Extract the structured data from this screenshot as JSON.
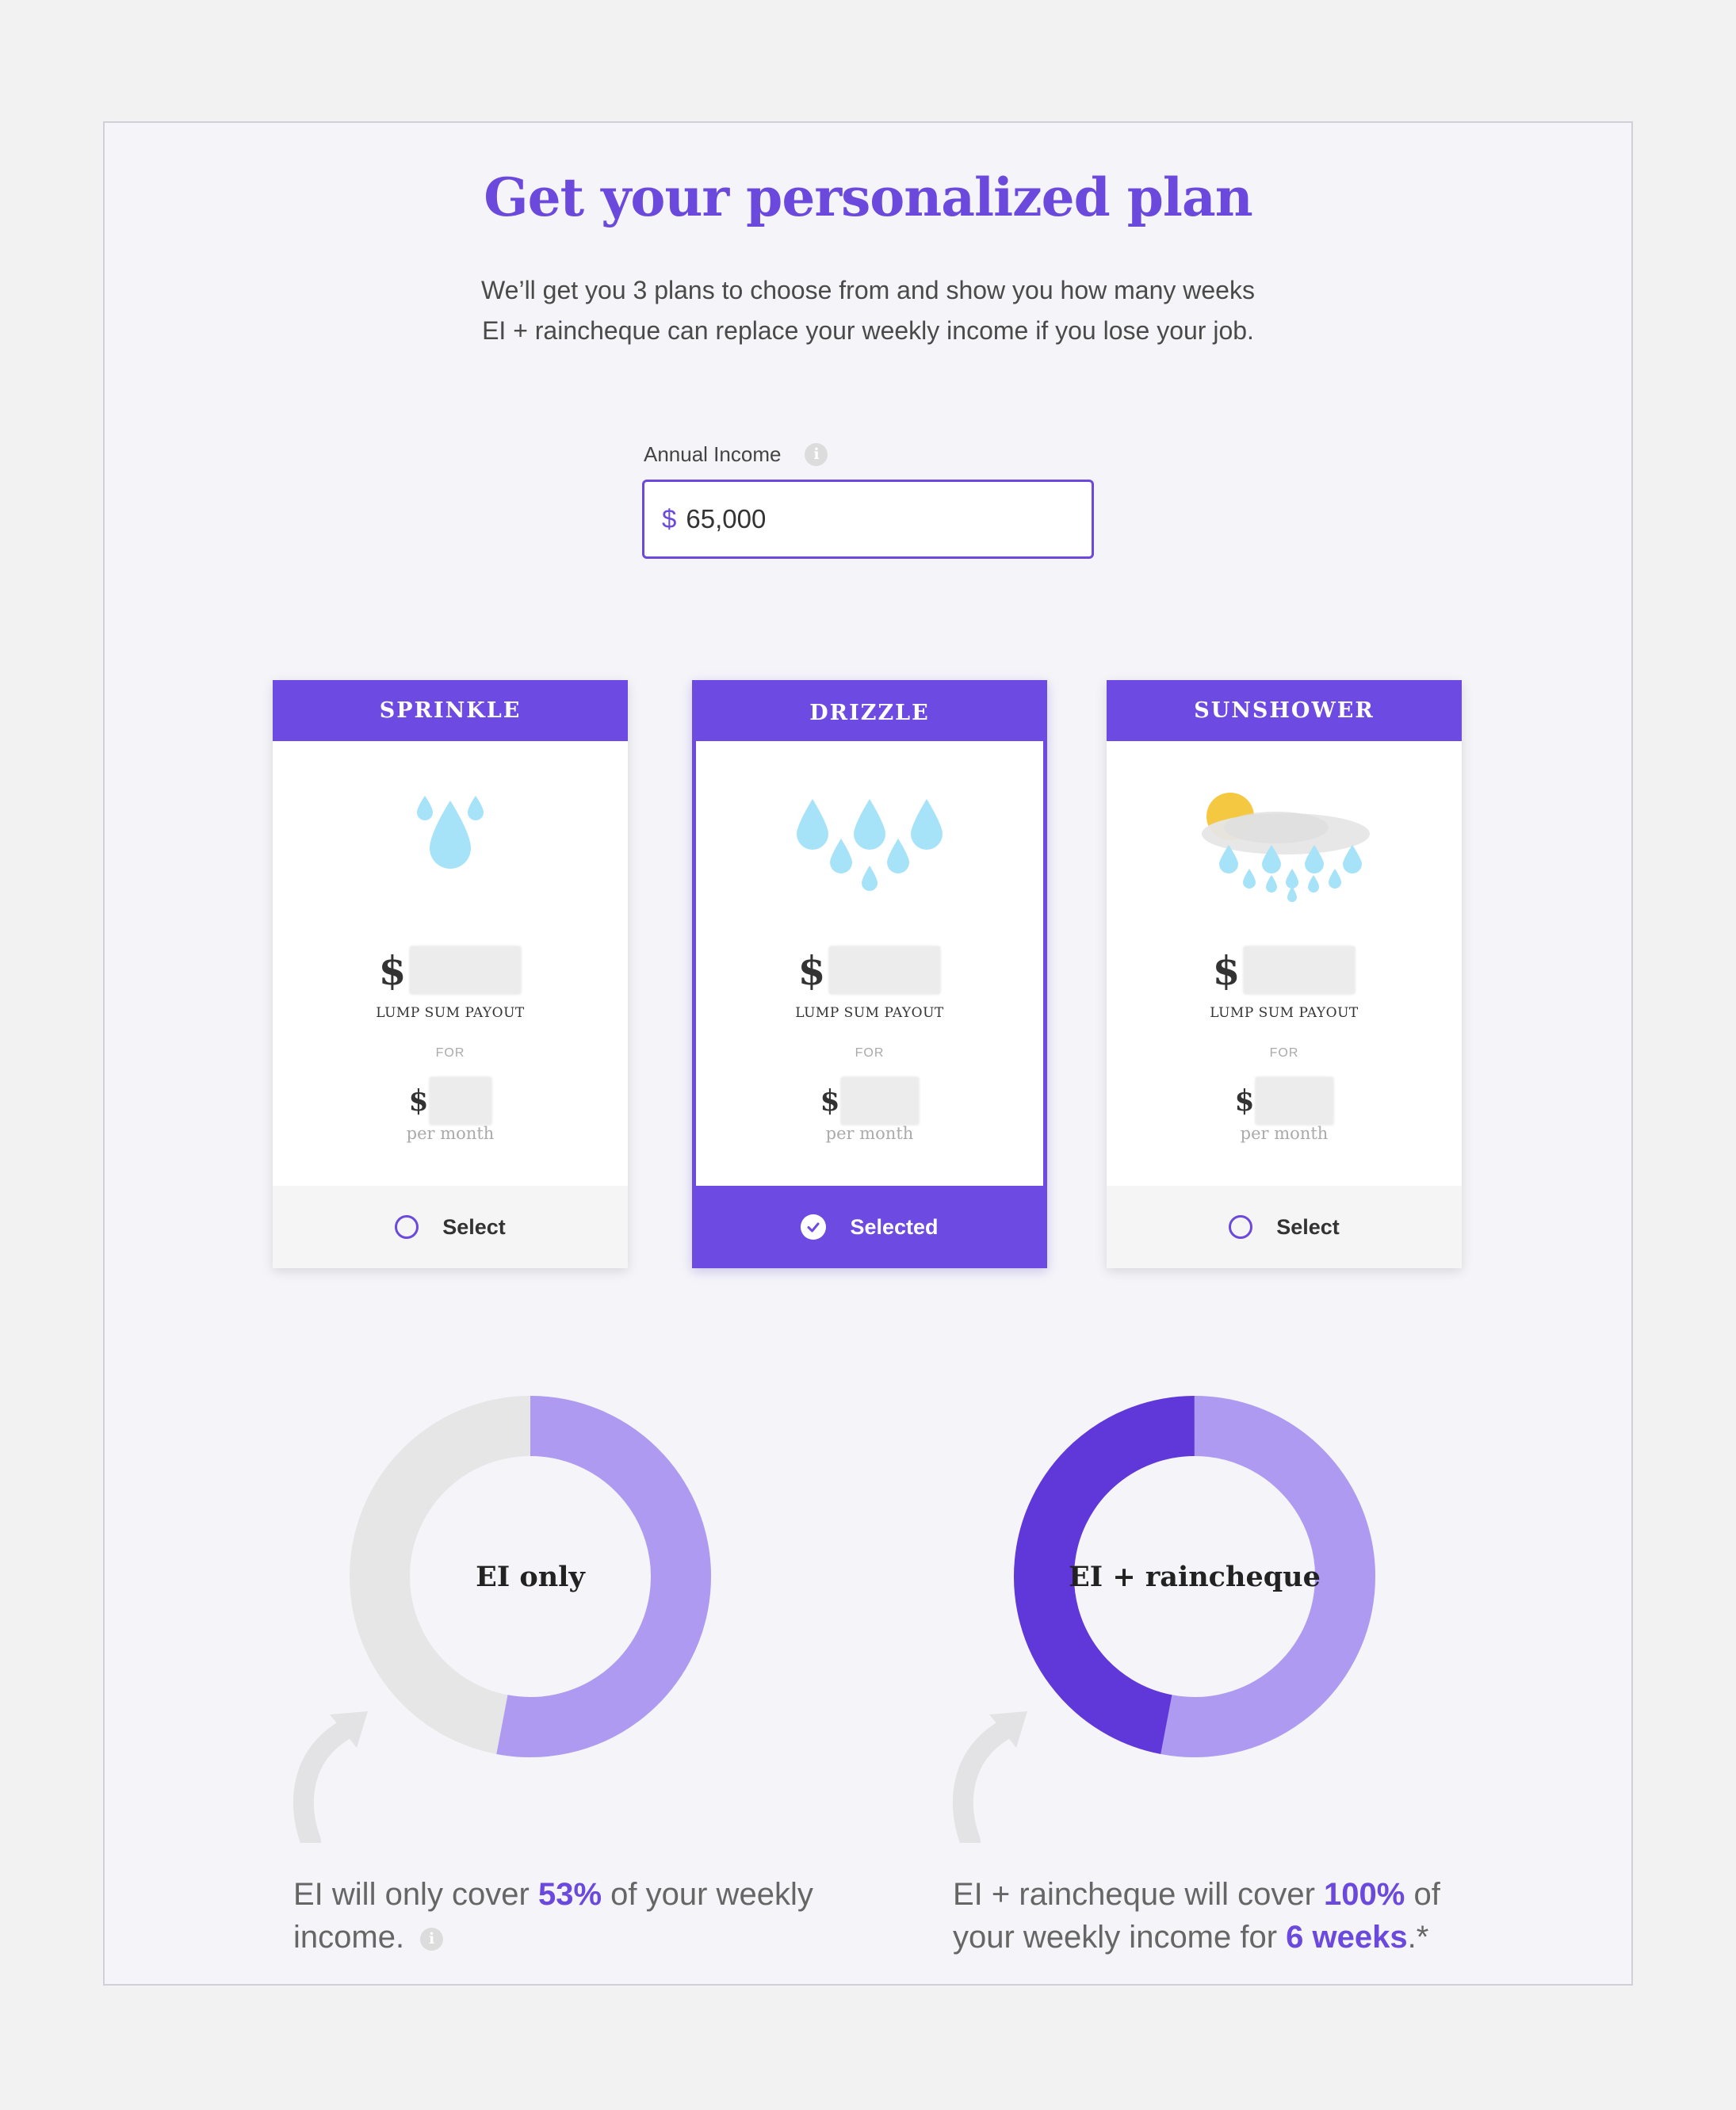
{
  "header": {
    "title": "Get your personalized plan",
    "subtitle_line1": "We’ll get you 3 plans to choose from and show you how many weeks",
    "subtitle_line2": "EI + raincheque can replace your weekly income if you lose your job."
  },
  "income": {
    "label": "Annual Income",
    "currency": "$",
    "value": "65,000",
    "info_icon": "info-icon"
  },
  "plans": [
    {
      "name": "SPRINKLE",
      "icon": "single-raindrop-icon",
      "lump_prefix": "$",
      "lump_label": "LUMP SUM PAYOUT",
      "for_label": "FOR",
      "monthly_prefix": "$",
      "per_month": "per month",
      "action": "Select",
      "selected": false
    },
    {
      "name": "DRIZZLE",
      "icon": "drizzle-raindrops-icon",
      "lump_prefix": "$",
      "lump_label": "LUMP SUM PAYOUT",
      "for_label": "FOR",
      "monthly_prefix": "$",
      "per_month": "per month",
      "action": "Selected",
      "selected": true
    },
    {
      "name": "SUNSHOWER",
      "icon": "sun-cloud-rain-icon",
      "lump_prefix": "$",
      "lump_label": "LUMP SUM PAYOUT",
      "for_label": "FOR",
      "monthly_prefix": "$",
      "per_month": "per month",
      "action": "Select",
      "selected": false
    }
  ],
  "coverage": {
    "ei_only": {
      "label": "EI only",
      "covered_fraction": 0.53,
      "caption_pre": "EI will only cover ",
      "caption_pct": "53%",
      "caption_post": " of your weekly income."
    },
    "ei_raincheque": {
      "label": "EI + raincheque",
      "ei_fraction": 0.53,
      "raincheque_fraction": 0.47,
      "caption_pre": "EI + raincheque will cover ",
      "caption_pct": "100%",
      "caption_mid": " of your weekly income for ",
      "caption_weeks": "6 weeks",
      "caption_post": ".*"
    }
  },
  "colors": {
    "accent": "#6b49dd",
    "card_header": "#6d4ae2",
    "donut_light": "#ae9bf1",
    "donut_dark": "#6038d9",
    "donut_empty": "#e6e6e6",
    "drop": "#a6e3f8"
  }
}
